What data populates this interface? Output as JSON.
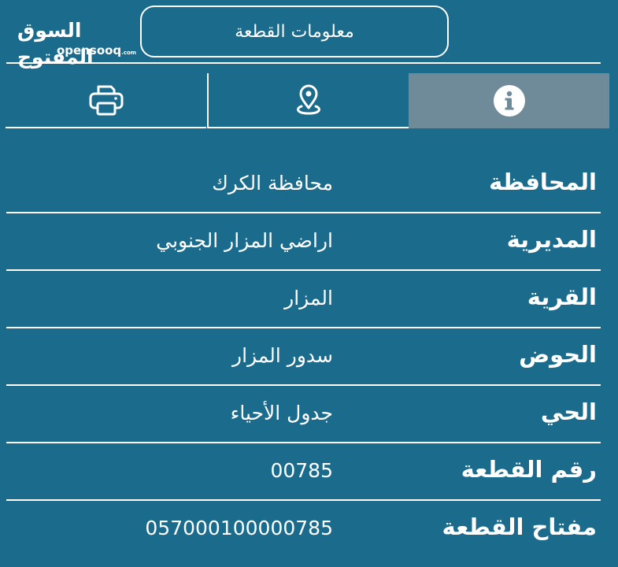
{
  "logo": {
    "arabic": "السوق المفتوح",
    "latin": "opensooq",
    "suffix": ".com"
  },
  "header": {
    "title": "معلومات القطعة"
  },
  "tabs": [
    {
      "icon": "print-icon",
      "active": false
    },
    {
      "icon": "location-pin-icon",
      "active": false
    },
    {
      "icon": "info-icon",
      "active": true
    }
  ],
  "colors": {
    "background": "#1b6b8c",
    "active_tab": "#6f8b99",
    "foreground": "#ffffff"
  },
  "rows": [
    {
      "label": "المحافظة",
      "value": "محافظة الكرك"
    },
    {
      "label": "المديرية",
      "value": "اراضي المزار الجنوبي"
    },
    {
      "label": "القرية",
      "value": "المزار"
    },
    {
      "label": "الحوض",
      "value": "سدور المزار"
    },
    {
      "label": "الحي",
      "value": "جدول الأحياء"
    },
    {
      "label": "رقم القطعة",
      "value": "00785"
    },
    {
      "label": "مفتاح القطعة",
      "value": "057000100000785"
    }
  ]
}
